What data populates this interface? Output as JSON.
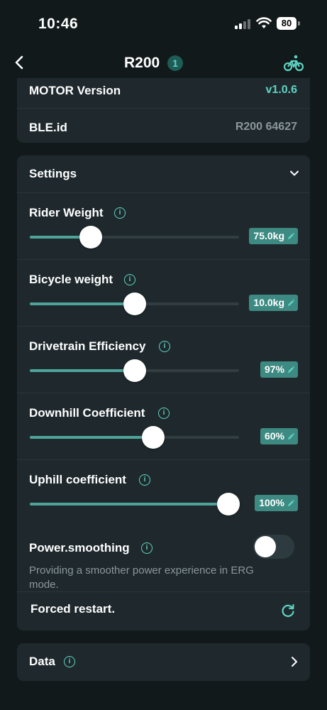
{
  "status_bar": {
    "time": "10:46",
    "battery": "80"
  },
  "nav": {
    "title": "R200",
    "badge": "1"
  },
  "device_info": {
    "motor_version": {
      "label": "MOTOR Version",
      "value": "v1.0.6"
    },
    "ble_id": {
      "label": "BLE.id",
      "value": "R200 64627"
    }
  },
  "settings": {
    "title": "Settings",
    "sliders": [
      {
        "label": "Rider Weight",
        "value": "75.0kg",
        "fraction": 0.29
      },
      {
        "label": "Bicycle weight",
        "value": "10.0kg",
        "fraction": 0.5
      },
      {
        "label": "Drivetrain Efficiency",
        "value": "97%",
        "fraction": 0.5
      },
      {
        "label": "Downhill Coefficient",
        "value": "60%",
        "fraction": 0.59
      },
      {
        "label": "Uphill coefficient",
        "value": "100%",
        "fraction": 0.95
      }
    ],
    "power_smoothing": {
      "label": "Power.smoothing",
      "enabled": false,
      "description": "Providing a smoother power experience in ERG mode."
    },
    "forced_restart": {
      "label": "Forced restart."
    }
  },
  "data_section": {
    "label": "Data"
  },
  "colors": {
    "background": "#11191b",
    "card": "#1f292d",
    "accent": "#5fd4c3",
    "value_badge": "#3d8a82",
    "slider_fill": "#4fa49a",
    "muted_text": "#8c979b"
  }
}
